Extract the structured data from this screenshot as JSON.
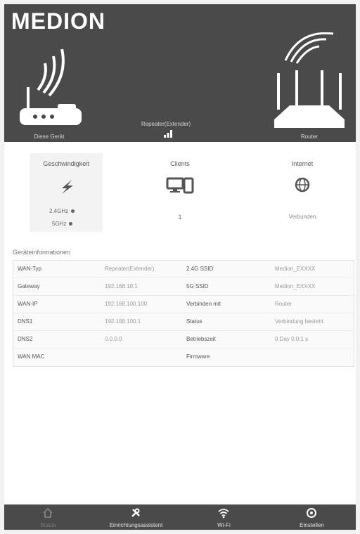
{
  "brand": {
    "logo": "MEDION"
  },
  "header": {
    "device_label": "Diese Gerät",
    "connection_label": "Repeater(Extender)",
    "router_label": "Router"
  },
  "summary": {
    "speed": {
      "title": "Geschwindigkeit",
      "band_24": "2.4GHz",
      "band_5": "5GHz"
    },
    "clients": {
      "title": "Clients",
      "count": "1"
    },
    "internet": {
      "title": "Internet",
      "status": "Verbunden"
    }
  },
  "status": {
    "title": "Geräteinformationen",
    "rows": [
      {
        "l1": "WAN-Typ",
        "v1": "Repeater(Extender)",
        "l2": "2.4G SSID",
        "v2": "Medion_EXXXX"
      },
      {
        "l1": "Gateway",
        "v1": "192.168.10.1",
        "l2": "5G SSID",
        "v2": "Medion_EXXXX"
      },
      {
        "l1": "WAN-IP",
        "v1": "192.168.100.100",
        "l2": "Verbinden mit",
        "v2": "Router"
      },
      {
        "l1": "DNS1",
        "v1": "192.168.100.1",
        "l2": "Status",
        "v2": "Verbindung besteht"
      },
      {
        "l1": "DNS2",
        "v1": "0.0.0.0",
        "l2": "Betriebszeit",
        "v2": "0 Day 0:0:1 s"
      },
      {
        "l1": "WAN MAC",
        "v1": "",
        "l2": "Firmware",
        "v2": ""
      }
    ]
  },
  "nav": [
    {
      "label": "Status",
      "icon": "home-icon"
    },
    {
      "label": "Einrichtungsassistent",
      "icon": "tools-icon"
    },
    {
      "label": "Wi-Fi",
      "icon": "wifi-icon"
    },
    {
      "label": "Einstellen",
      "icon": "settings-icon"
    }
  ],
  "colors": {
    "header": "#4a4a4a",
    "nav": "#4a4a4a",
    "background": "#ffffff"
  }
}
